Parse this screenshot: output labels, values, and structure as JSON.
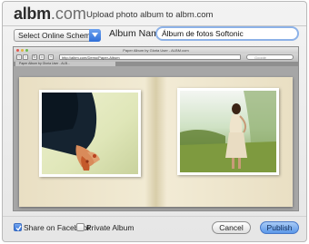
{
  "header": {
    "logo_bold": "albm",
    "logo_light": ".com",
    "title": "Upload photo album to albm.com"
  },
  "form": {
    "scheme_select_value": "Select Online Scheme",
    "album_name_label": "Album Name",
    "album_name_value": "Álbum de fotos Softonic"
  },
  "preview": {
    "window_title": "Paper Album by Gloria User - ALBM.com",
    "url": "http://albm.com/Demo/Paper-Album",
    "search_placeholder": "Google",
    "tab_label": "Paper Album by Gloria User - ALB..."
  },
  "options": {
    "share_facebook_label": "Share on Facebook",
    "share_facebook_checked": true,
    "private_album_label": "Private Album",
    "private_album_checked": false
  },
  "buttons": {
    "cancel_label": "Cancel",
    "publish_label": "Publish"
  },
  "colors": {
    "accent_blue": "#5a97e8",
    "book_paper": "#efe6cc",
    "input_focus": "#8db2e8"
  }
}
